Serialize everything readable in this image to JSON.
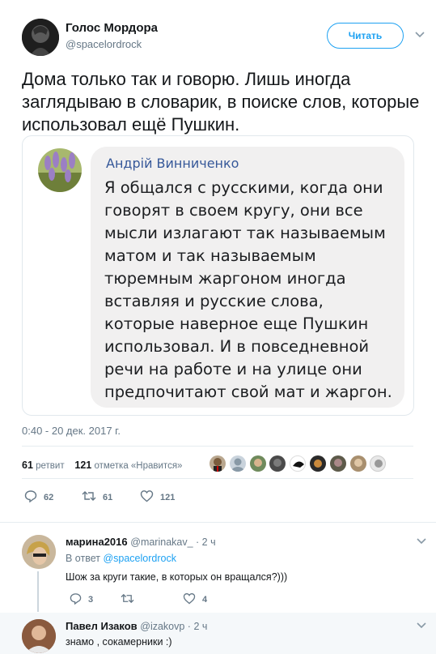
{
  "tweet": {
    "author_name": "Голос Мордора",
    "author_handle": "@spacelordrock",
    "follow_label": "Читать",
    "text": "Дома только так и говорю. Лишь иногда заглядываю в словарик, в поиске слов, которые использовал ещё Пушкин.",
    "timestamp": "0:40 - 20 дек. 2017 г.",
    "retweets_count": "61",
    "retweets_label": "ретвит",
    "likes_count": "121",
    "likes_label": "отметка «Нравится»",
    "actions": {
      "replies": "62",
      "retweets": "61",
      "likes": "121"
    }
  },
  "quote": {
    "name": "Андрій Винниченко",
    "text": "Я общался с русскими, когда они говорят в своем кругу, они все мысли излагают так называемым матом  и так называемым тюремным жаргоном  иногда вставляя и русские слова, которые наверное еще Пушкин использовал. И в повседневной речи на работе и на улице они предпочитают свой мат и жаргон."
  },
  "replies": [
    {
      "name": "марина2016",
      "handle": "@marinakav_ · 2 ч",
      "reply_to_prefix": "В ответ",
      "reply_to_handle": "@spacelordrock",
      "text": "Шож за круги такие, в которых он вращался?)))",
      "actions": {
        "replies": "3",
        "retweets": "",
        "likes": "4"
      }
    },
    {
      "name": "Павел Изаков",
      "handle": "@izakovp · 2 ч",
      "text": "знамо , сокамерники  :)"
    }
  ],
  "colors": {
    "accent": "#1da1f2",
    "text": "#14171a",
    "muted": "#657786",
    "bubble": "#f1f0f0",
    "fb_name": "#365899"
  },
  "icons": [
    "chevron-down-icon",
    "reply-icon",
    "retweet-icon",
    "like-icon"
  ]
}
